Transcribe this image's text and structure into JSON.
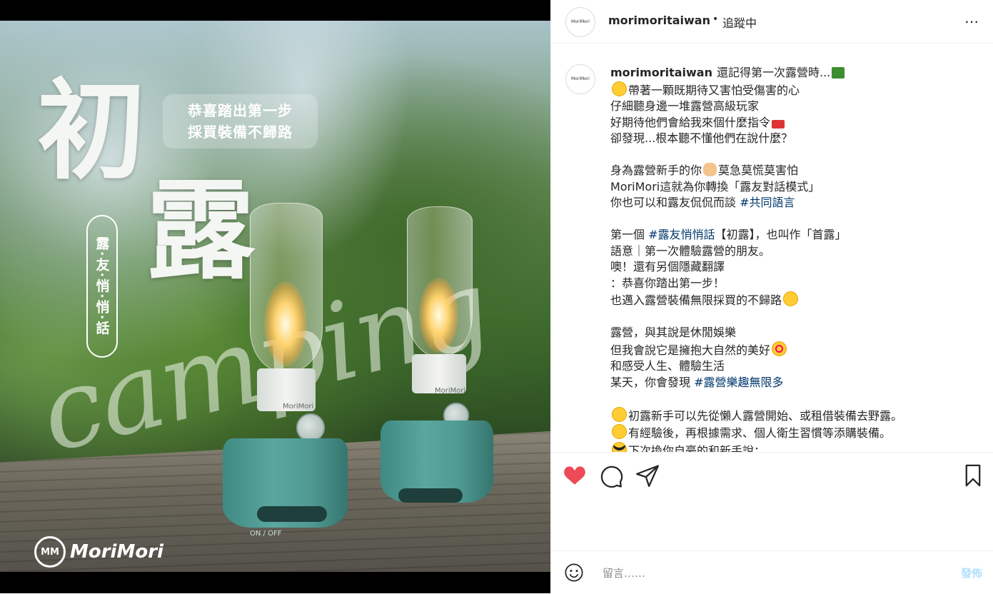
{
  "media": {
    "headline_char_1": "初",
    "headline_char_2": "露",
    "banner_line_1": "恭喜踏出第一步",
    "banner_line_2": "採買裝備不歸路",
    "vertical_label": "露·友·悄·悄·話",
    "script_word": "camping",
    "lamp_brand": "MoriMori",
    "lamp_switch_text": "ON / OFF",
    "logo_text": "MoriMori",
    "logo_mark": "MM",
    "base_color": "#4f9a93"
  },
  "header": {
    "username": "morimoritaiwan",
    "separator": "•",
    "follow_state": "追蹤中",
    "more_icon": "⋯",
    "avatar_text": "MoriMori"
  },
  "caption": {
    "username": "morimoritaiwan",
    "lines": [
      {
        "text": "還記得第一次露營時...",
        "emoji_after": "tent-icon"
      },
      {
        "emoji_before": "grimace-emoji",
        "text": "帶著一顆既期待又害怕受傷害的心"
      },
      {
        "text": "仔細聽身邊一堆露營高級玩家"
      },
      {
        "text": "好期待他們會給我來個什麼指令",
        "emoji_after": "megaphone-icon"
      },
      {
        "text": "卻發現...根本聽不懂他們在說什麼？"
      },
      {
        "text": ""
      },
      {
        "text": "身為露營新手的你",
        "emoji_mid": "ok-hand-emoji",
        "text2": "莫急莫慌莫害怕"
      },
      {
        "text": "MoriMori這就為你轉換「露友對話模式」"
      },
      {
        "text": "你也可以和露友侃侃而談 ",
        "tag": "#共同語言"
      },
      {
        "text": ""
      },
      {
        "text": "第一個 ",
        "tag": "#露友悄悄話",
        "text2": "【初露】，也叫作「首露」"
      },
      {
        "text": "語意｜第一次體驗露營的朋友。"
      },
      {
        "text": "噢！還有另個隱藏翻譯"
      },
      {
        "text": "：恭喜你踏出第一步！"
      },
      {
        "text": "也邁入露營裝備無限採買的不歸路",
        "emoji_after": "grin-sweat-emoji"
      },
      {
        "text": ""
      },
      {
        "text": "露營，與其說是休閒娛樂"
      },
      {
        "text": "但我會說它是擁抱大自然的美好",
        "emoji_after": "heart-eyes-emoji"
      },
      {
        "text": "和感受人生、體驗生活"
      },
      {
        "text": "某天，你會發現 ",
        "tag": "#露營樂趣無限多"
      },
      {
        "text": ""
      },
      {
        "emoji_before": "yellow-circle-icon",
        "text": "初露新手可以先從懶人露營開始、或租借裝備去野露。"
      },
      {
        "emoji_before": "yellow-circle-icon",
        "text": "有經驗後，再根據需求、個人衛生習慣等添購裝備。"
      },
      {
        "emoji_before": "sunglasses-emoji",
        "text": "下次換你自豪的和新手說："
      }
    ]
  },
  "actions": {
    "like_color": "#ed4956",
    "like_state": "liked"
  },
  "comment_bar": {
    "placeholder": "留言……",
    "post_label": "發佈"
  }
}
